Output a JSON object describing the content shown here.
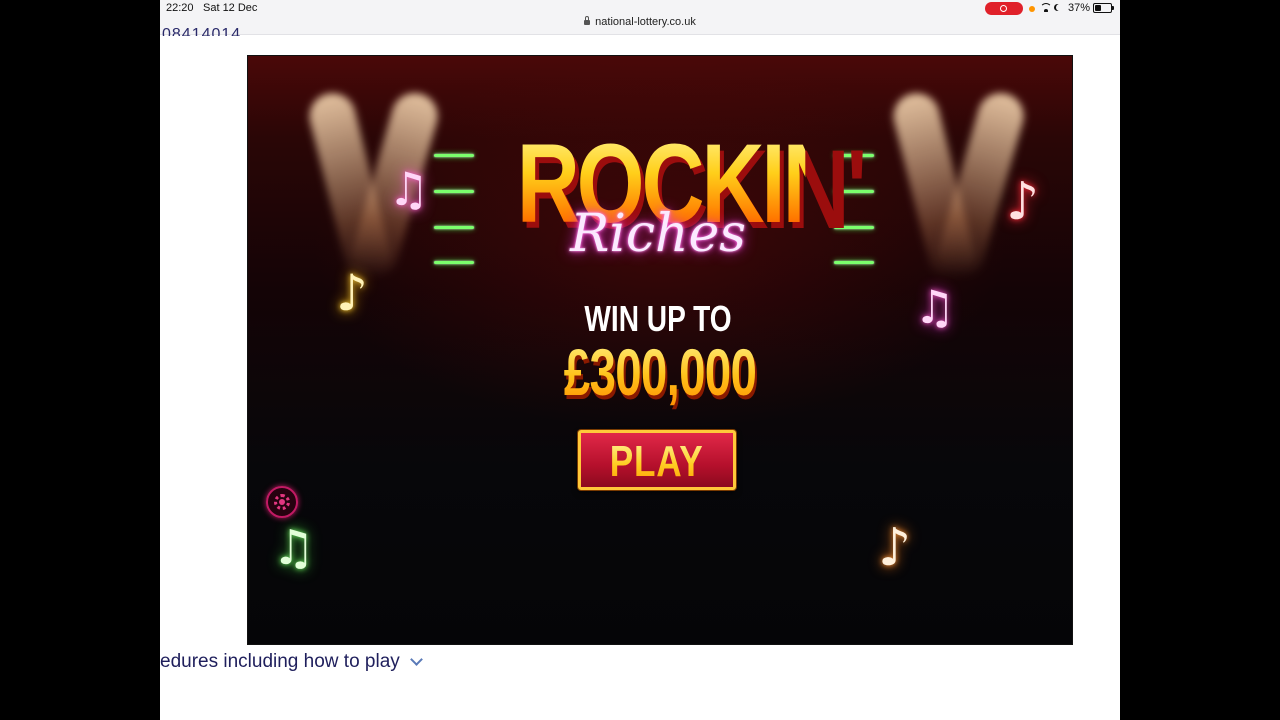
{
  "status_bar": {
    "time": "22:20",
    "date": "Sat 12 Dec",
    "url": "national-lottery.co.uk",
    "battery_percent": "37%",
    "battery_level": 0.37,
    "recording_color": "#e0212a"
  },
  "page": {
    "cut_off_number": "08414014",
    "bottom_text": "edures including how to play",
    "expand_icon": "chevron-down-icon"
  },
  "game": {
    "title_main": "ROCKIN'",
    "title_script": "Riches",
    "win_up_to": "WIN UP TO",
    "prize": "£300,000",
    "play_label": "PLAY",
    "settings_icon": "settings-gear-icon",
    "note_glyphs": {
      "pair": "♫",
      "single": "♪"
    },
    "colors": {
      "title_gold": "#ffcf1a",
      "riches_glow": "#ff4fd8",
      "button_red": "#c4143a",
      "button_border": "#ffc93a",
      "note_green": "#7bff6c",
      "note_pink": "#ff5fd0",
      "note_red": "#ff2a3a",
      "note_yellow": "#ffd23a",
      "note_orange": "#ff9a3a"
    }
  }
}
